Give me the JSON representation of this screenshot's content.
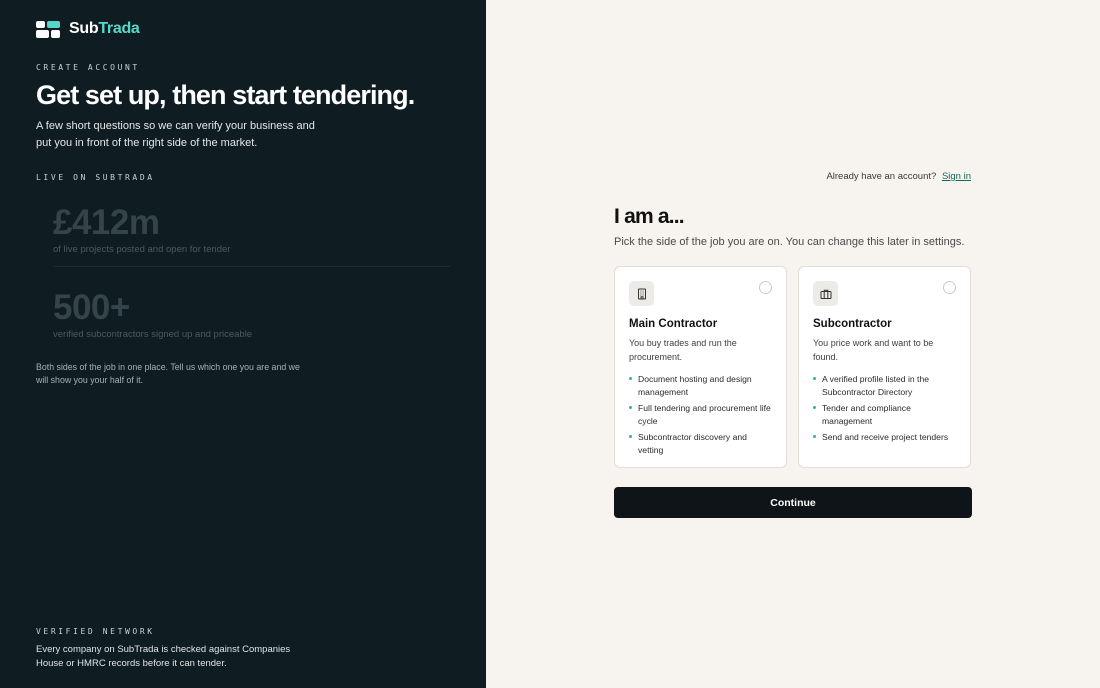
{
  "brand": {
    "name_part1": "Sub",
    "name_part2": "Trada",
    "accent_color": "#56d8c8"
  },
  "left": {
    "eyebrow_create": "CREATE ACCOUNT",
    "headline": "Get set up, then start tendering.",
    "intro": "A few short questions so we can verify your business and put you in front of the right side of the market.",
    "eyebrow_live": "LIVE ON SUBTRADA",
    "stats": [
      {
        "value": "£412m",
        "label": "of live projects posted and open for tender"
      },
      {
        "value": "500+",
        "label": "verified subcontractors signed up and priceable"
      }
    ],
    "both_sides": "Both sides of the job in one place. Tell us which one you are and we will show you your half of it.",
    "eyebrow_verified": "VERIFIED NETWORK",
    "verified_text": "Every company on SubTrada is checked against Companies House or HMRC records before it can tender."
  },
  "right": {
    "signin_prompt": "Already have an account?",
    "signin_link": "Sign in",
    "title": "I am a...",
    "subtitle": "Pick the side of the job you are on. You can change this later in settings.",
    "cards": [
      {
        "icon": "building-icon",
        "title": "Main Contractor",
        "description": "You buy trades and run the procurement.",
        "features": [
          "Document hosting and design management",
          "Full tendering and procurement life cycle",
          "Subcontractor discovery and vetting"
        ],
        "selected": false
      },
      {
        "icon": "briefcase-icon",
        "title": "Subcontractor",
        "description": "You price work and want to be found.",
        "features": [
          "A verified profile listed in the Subcontractor Directory",
          "Tender and compliance management",
          "Send and receive project tenders"
        ],
        "selected": false
      }
    ],
    "continue_label": "Continue"
  }
}
